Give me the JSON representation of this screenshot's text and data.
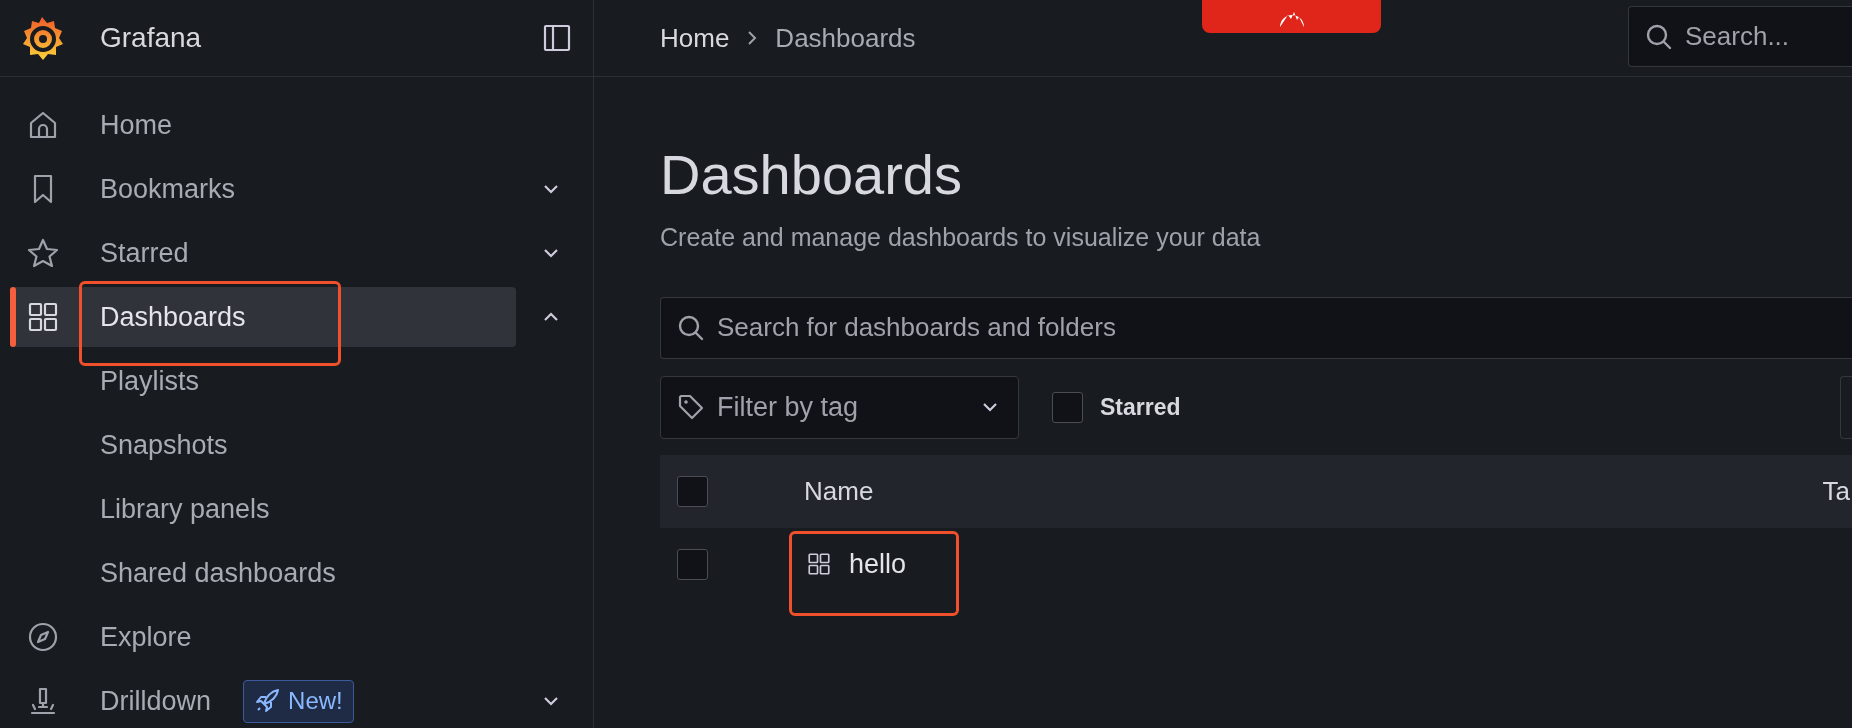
{
  "app": {
    "name": "Grafana"
  },
  "sidebar": {
    "items": [
      {
        "label": "Home",
        "selected": false
      },
      {
        "label": "Bookmarks",
        "selected": false,
        "expanded": false
      },
      {
        "label": "Starred",
        "selected": false,
        "expanded": false
      },
      {
        "label": "Dashboards",
        "selected": true,
        "expanded": true,
        "children": [
          {
            "label": "Playlists"
          },
          {
            "label": "Snapshots"
          },
          {
            "label": "Library panels"
          },
          {
            "label": "Shared dashboards"
          }
        ]
      },
      {
        "label": "Explore",
        "selected": false
      },
      {
        "label": "Drilldown",
        "selected": false,
        "expanded": false,
        "badge": "New!"
      }
    ]
  },
  "breadcrumb": [
    "Home",
    "Dashboards"
  ],
  "top_search": {
    "placeholder": "Search..."
  },
  "page": {
    "title": "Dashboards",
    "subtitle": "Create and manage dashboards to visualize your data"
  },
  "search": {
    "placeholder": "Search for dashboards and folders"
  },
  "filter": {
    "placeholder": "Filter by tag"
  },
  "starred_filter": {
    "label": "Starred",
    "checked": false
  },
  "table": {
    "header_checked": false,
    "columns": [
      "Name",
      "Ta"
    ],
    "rows": [
      {
        "name": "hello",
        "checked": false
      }
    ]
  }
}
